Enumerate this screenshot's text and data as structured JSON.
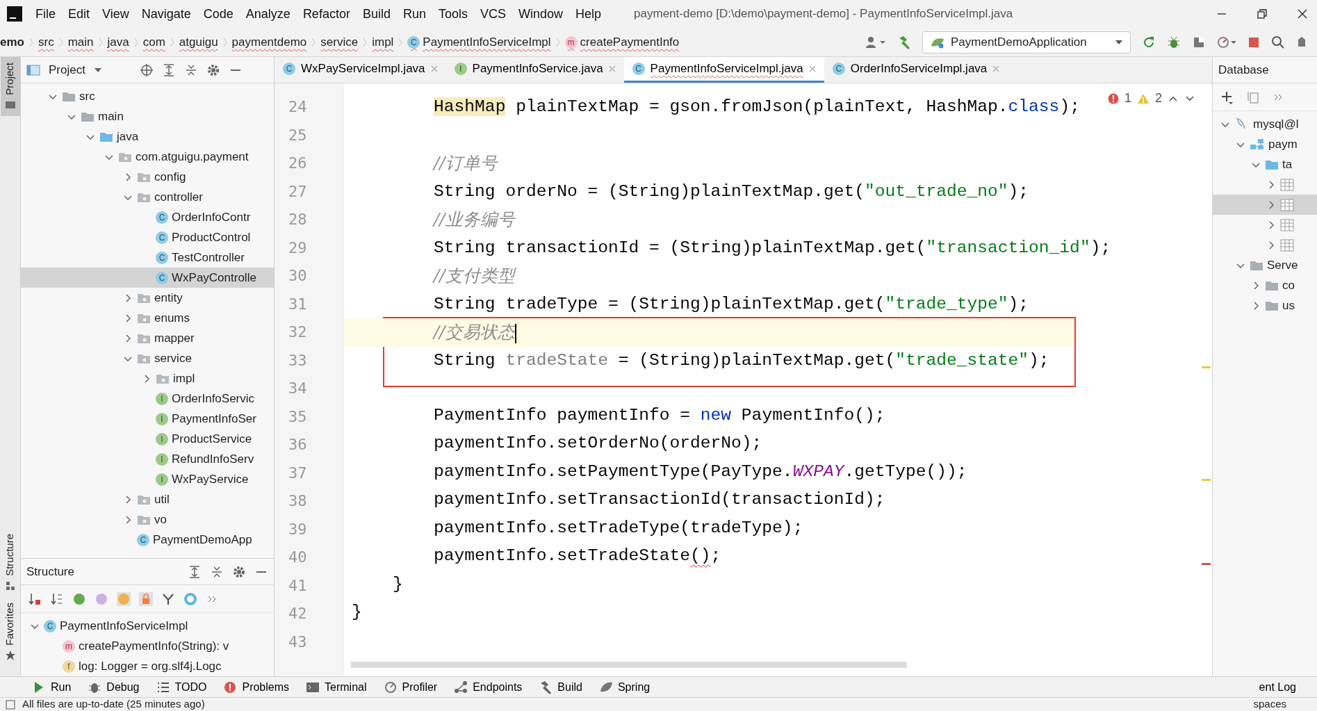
{
  "window": {
    "title": "payment-demo [D:\\demo\\payment-demo] - PaymentInfoServiceImpl.java"
  },
  "menu": [
    "File",
    "Edit",
    "View",
    "Navigate",
    "Code",
    "Analyze",
    "Refactor",
    "Build",
    "Run",
    "Tools",
    "VCS",
    "Window",
    "Help"
  ],
  "breadcrumbs": [
    {
      "label": "emo",
      "kind": "project"
    },
    {
      "label": "src",
      "kind": "dir"
    },
    {
      "label": "main",
      "kind": "dir"
    },
    {
      "label": "java",
      "kind": "dir"
    },
    {
      "label": "com",
      "kind": "dir"
    },
    {
      "label": "atguigu",
      "kind": "dir"
    },
    {
      "label": "paymentdemo",
      "kind": "dir"
    },
    {
      "label": "service",
      "kind": "dir"
    },
    {
      "label": "impl",
      "kind": "dir"
    },
    {
      "label": "PaymentInfoServiceImpl",
      "kind": "class",
      "badge": "C"
    },
    {
      "label": "createPaymentInfo",
      "kind": "method",
      "badge": "m"
    }
  ],
  "run_config": {
    "label": "PaymentDemoApplication"
  },
  "side_tabs": [
    {
      "label": "Project",
      "kind": "project",
      "selected": true
    },
    {
      "label": "Structure",
      "kind": "structure",
      "selected": false
    },
    {
      "label": "Favorites",
      "kind": "favorites",
      "selected": false
    }
  ],
  "project_panel": {
    "title": "Project",
    "tree": [
      {
        "label": "src",
        "kind": "folder",
        "expanded": true,
        "selected": false,
        "children": [
          {
            "label": "main",
            "kind": "folder",
            "expanded": true,
            "selected": false,
            "children": [
              {
                "label": "java",
                "kind": "srcfolder",
                "expanded": true,
                "selected": false,
                "children": [
                  {
                    "label": "com.atguigu.payment",
                    "kind": "package",
                    "expanded": true,
                    "selected": false,
                    "children": [
                      {
                        "label": "config",
                        "kind": "package",
                        "expanded": false,
                        "selected": false
                      },
                      {
                        "label": "controller",
                        "kind": "package",
                        "expanded": true,
                        "selected": false,
                        "children": [
                          {
                            "label": "OrderInfoContr",
                            "kind": "class",
                            "badge": "C",
                            "selected": false
                          },
                          {
                            "label": "ProductControl",
                            "kind": "class",
                            "badge": "C",
                            "selected": false
                          },
                          {
                            "label": "TestController",
                            "kind": "class",
                            "badge": "C",
                            "selected": false
                          },
                          {
                            "label": "WxPayControlle",
                            "kind": "class",
                            "badge": "C",
                            "selected": true
                          }
                        ]
                      },
                      {
                        "label": "entity",
                        "kind": "package",
                        "expanded": false,
                        "selected": false
                      },
                      {
                        "label": "enums",
                        "kind": "package",
                        "expanded": false,
                        "selected": false
                      },
                      {
                        "label": "mapper",
                        "kind": "package",
                        "expanded": false,
                        "selected": false
                      },
                      {
                        "label": "service",
                        "kind": "package",
                        "expanded": true,
                        "selected": false,
                        "children": [
                          {
                            "label": "impl",
                            "kind": "package",
                            "expanded": false,
                            "selected": false
                          },
                          {
                            "label": "OrderInfoServic",
                            "kind": "interface",
                            "badge": "I",
                            "selected": false
                          },
                          {
                            "label": "PaymentInfoSer",
                            "kind": "interface",
                            "badge": "I",
                            "selected": false
                          },
                          {
                            "label": "ProductService",
                            "kind": "interface",
                            "badge": "I",
                            "selected": false
                          },
                          {
                            "label": "RefundInfoServ",
                            "kind": "interface",
                            "badge": "I",
                            "selected": false
                          },
                          {
                            "label": "WxPayService",
                            "kind": "interface",
                            "badge": "I",
                            "selected": false
                          }
                        ]
                      },
                      {
                        "label": "util",
                        "kind": "package",
                        "expanded": false,
                        "selected": false
                      },
                      {
                        "label": "vo",
                        "kind": "package",
                        "expanded": false,
                        "selected": false
                      },
                      {
                        "label": "PaymentDemoApp",
                        "kind": "app",
                        "badge": "C",
                        "selected": false
                      }
                    ]
                  }
                ]
              }
            ]
          }
        ]
      }
    ]
  },
  "structure_panel": {
    "title": "Structure",
    "tree": [
      {
        "label": "PaymentInfoServiceImpl",
        "kind": "class",
        "badge": "C",
        "expanded": true,
        "selected": false,
        "children": [
          {
            "label": "createPaymentInfo(String): v",
            "kind": "method",
            "badge": "m",
            "selected": false
          },
          {
            "label": "log: Logger = org.slf4j.Logc",
            "kind": "field",
            "badge": "f",
            "selected": false
          }
        ]
      }
    ]
  },
  "editor_tabs": [
    {
      "label": "WxPayServiceImpl.java",
      "kind": "class",
      "badge": "C",
      "selected": false
    },
    {
      "label": "PaymentInfoService.java",
      "kind": "interface",
      "badge": "I",
      "selected": false
    },
    {
      "label": "PaymentInfoServiceImpl.java",
      "kind": "class",
      "badge": "C",
      "selected": true
    },
    {
      "label": "OrderInfoServiceImpl.java",
      "kind": "class",
      "badge": "C",
      "selected": false
    }
  ],
  "inspections": {
    "errors": "1",
    "warnings": "2"
  },
  "code_lines": [
    {
      "number": "24",
      "tokens": [
        {
          "text": "        HashMap",
          "kind": "highlight"
        },
        {
          "text": " plainTextMap = gson.fromJson(plainText, HashMap.",
          "kind": "plain"
        },
        {
          "text": "class",
          "kind": "keyword"
        },
        {
          "text": ");",
          "kind": "plain"
        }
      ]
    },
    {
      "number": "25"
    },
    {
      "number": "26",
      "tokens": [
        {
          "text": "        //订单号",
          "kind": "comment"
        }
      ]
    },
    {
      "number": "27",
      "tokens": [
        {
          "text": "        String orderNo = (String)plainTextMap.get(",
          "kind": "plain"
        },
        {
          "text": "\"out_trade_no\"",
          "kind": "string"
        },
        {
          "text": ");",
          "kind": "plain"
        }
      ]
    },
    {
      "number": "28",
      "tokens": [
        {
          "text": "        //业务编号",
          "kind": "comment"
        }
      ]
    },
    {
      "number": "29",
      "tokens": [
        {
          "text": "        String transactionId = (String)plainTextMap.get(",
          "kind": "plain"
        },
        {
          "text": "\"transaction_id\"",
          "kind": "string"
        },
        {
          "text": ");",
          "kind": "plain"
        }
      ]
    },
    {
      "number": "30",
      "tokens": [
        {
          "text": "        //支付类型",
          "kind": "comment"
        }
      ]
    },
    {
      "number": "31",
      "tokens": [
        {
          "text": "        String tradeType = (String)plainTextMap.get(",
          "kind": "plain"
        },
        {
          "text": "\"trade_type\"",
          "kind": "string"
        },
        {
          "text": ");",
          "kind": "plain"
        }
      ]
    },
    {
      "number": "32",
      "boxed": true,
      "current": true,
      "caret": true,
      "tokens": [
        {
          "text": "        //交易状态",
          "kind": "comment"
        }
      ]
    },
    {
      "number": "33",
      "boxed": true,
      "stripe_warning": true,
      "tokens": [
        {
          "text": "        String ",
          "kind": "plain"
        },
        {
          "text": "tradeState",
          "kind": "unused"
        },
        {
          "text": " = (String)plainTextMap.get(",
          "kind": "plain"
        },
        {
          "text": "\"trade_state\"",
          "kind": "string"
        },
        {
          "text": ");",
          "kind": "plain"
        }
      ]
    },
    {
      "number": "34"
    },
    {
      "number": "35",
      "tokens": [
        {
          "text": "        PaymentInfo paymentInfo = ",
          "kind": "plain"
        },
        {
          "text": "new",
          "kind": "keyword"
        },
        {
          "text": " PaymentInfo();",
          "kind": "plain"
        }
      ]
    },
    {
      "number": "36",
      "tokens": [
        {
          "text": "        paymentInfo.setOrderNo(orderNo);",
          "kind": "plain"
        }
      ]
    },
    {
      "number": "37",
      "stripe_warning": true,
      "tokens": [
        {
          "text": "        paymentInfo.setPaymentType(PayType.",
          "kind": "plain"
        },
        {
          "text": "WXPAY",
          "kind": "field"
        },
        {
          "text": ".getType());",
          "kind": "plain"
        }
      ]
    },
    {
      "number": "38",
      "tokens": [
        {
          "text": "        paymentInfo.setTransactionId(transactionId);",
          "kind": "plain"
        }
      ]
    },
    {
      "number": "39",
      "tokens": [
        {
          "text": "        paymentInfo.setTradeType(tradeType);",
          "kind": "plain"
        }
      ]
    },
    {
      "number": "40",
      "stripe_error": true,
      "tokens": [
        {
          "text": "        paymentInfo.setTradeState",
          "kind": "plain"
        },
        {
          "text": "()",
          "kind": "error"
        },
        {
          "text": ";",
          "kind": "plain"
        }
      ]
    },
    {
      "number": "41",
      "tokens": [
        {
          "text": "    }",
          "kind": "plain"
        }
      ]
    },
    {
      "number": "42",
      "tokens": [
        {
          "text": "}",
          "kind": "plain"
        }
      ]
    },
    {
      "number": "43"
    }
  ],
  "database_panel": {
    "title": "Database",
    "tree": [
      {
        "label": "mysql@l",
        "kind": "datasource",
        "expanded": true,
        "selected": false,
        "children": [
          {
            "label": "paym",
            "kind": "schema",
            "expanded": true,
            "selected": false,
            "children": [
              {
                "label": "ta",
                "kind": "srcfolder",
                "expanded": true,
                "selected": false,
                "children": [
                  {
                    "kind": "table",
                    "expanded": false,
                    "selected": false
                  },
                  {
                    "kind": "table",
                    "expanded": false,
                    "selected": true
                  },
                  {
                    "kind": "table",
                    "expanded": false,
                    "selected": false
                  },
                  {
                    "kind": "table",
                    "expanded": false,
                    "selected": false
                  }
                ]
              }
            ]
          },
          {
            "label": "Serve",
            "kind": "folder",
            "expanded": true,
            "selected": false,
            "children": [
              {
                "label": "co",
                "kind": "folder",
                "expanded": false,
                "selected": false
              },
              {
                "label": "us",
                "kind": "folder",
                "expanded": false,
                "selected": false
              }
            ]
          }
        ]
      }
    ]
  },
  "bottom_tools": [
    {
      "label": "Run",
      "kind": "run"
    },
    {
      "label": "Debug",
      "kind": "debug"
    },
    {
      "label": "TODO",
      "kind": "todo"
    },
    {
      "label": "Problems",
      "kind": "problems"
    },
    {
      "label": "Terminal",
      "kind": "terminal"
    },
    {
      "label": "Profiler",
      "kind": "profiler"
    },
    {
      "label": "Endpoints",
      "kind": "endpoints"
    },
    {
      "label": "Build",
      "kind": "build"
    },
    {
      "label": "Spring",
      "kind": "spring"
    }
  ],
  "bottom_right": "ent Log",
  "status_bar": {
    "message": "All files are up-to-date (25 minutes ago)",
    "right": "spaces"
  }
}
